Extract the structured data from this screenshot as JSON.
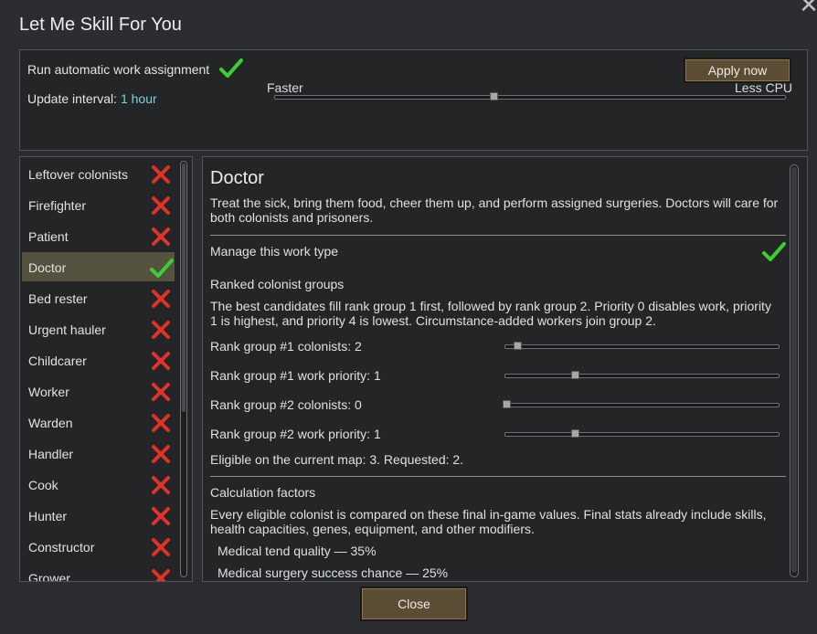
{
  "window": {
    "title": "Let Me Skill For You",
    "close_glyph": "✕"
  },
  "top": {
    "run_label": "Run automatic work assignment",
    "interval_label": "Update interval:",
    "interval_value": "1 hour",
    "apply_label": "Apply now",
    "slider_left": "Faster",
    "slider_right": "Less CPU",
    "slider_position": 0.43
  },
  "worktypes": [
    {
      "label": "Leftover colonists",
      "enabled": false
    },
    {
      "label": "Firefighter",
      "enabled": false
    },
    {
      "label": "Patient",
      "enabled": false
    },
    {
      "label": "Doctor",
      "enabled": true,
      "selected": true
    },
    {
      "label": "Bed rester",
      "enabled": false
    },
    {
      "label": "Urgent hauler",
      "enabled": false
    },
    {
      "label": "Childcarer",
      "enabled": false
    },
    {
      "label": "Worker",
      "enabled": false
    },
    {
      "label": "Warden",
      "enabled": false
    },
    {
      "label": "Handler",
      "enabled": false
    },
    {
      "label": "Cook",
      "enabled": false
    },
    {
      "label": "Hunter",
      "enabled": false
    },
    {
      "label": "Constructor",
      "enabled": false
    },
    {
      "label": "Grower",
      "enabled": false
    }
  ],
  "detail": {
    "title": "Doctor",
    "description": "Treat the sick, bring them food, cheer them up, and perform assigned surgeries. Doctors will care for both colonists and prisoners.",
    "manage_label": "Manage this work type",
    "ranked_heading": "Ranked colonist groups",
    "ranked_text": "The best candidates fill rank group 1 first, followed by rank group 2. Priority 0 disables work, priority 1 is highest, and priority 4 is lowest. Circumstance-added workers join group 2.",
    "sliders": [
      {
        "label": "Rank group #1 colonists: 2",
        "position": 0.04
      },
      {
        "label": "Rank group #1 work priority: 1",
        "position": 0.25
      },
      {
        "label": "Rank group #2 colonists: 0",
        "position": 0.0
      },
      {
        "label": "Rank group #2 work priority: 1",
        "position": 0.25
      }
    ],
    "eligible": "Eligible on the current map: 3. Requested: 2.",
    "calc_heading": "Calculation factors",
    "calc_text": "Every eligible colonist is compared on these final in-game values. Final stats already include skills, health capacities, genes, equipment, and other modifiers.",
    "factors": [
      "Medical tend quality — 35%",
      "Medical surgery success chance — 25%"
    ]
  },
  "footer": {
    "close_label": "Close"
  },
  "colors": {
    "check": "#3ccf32",
    "cross": "#e0312b",
    "accent": "#7ad0e6"
  }
}
